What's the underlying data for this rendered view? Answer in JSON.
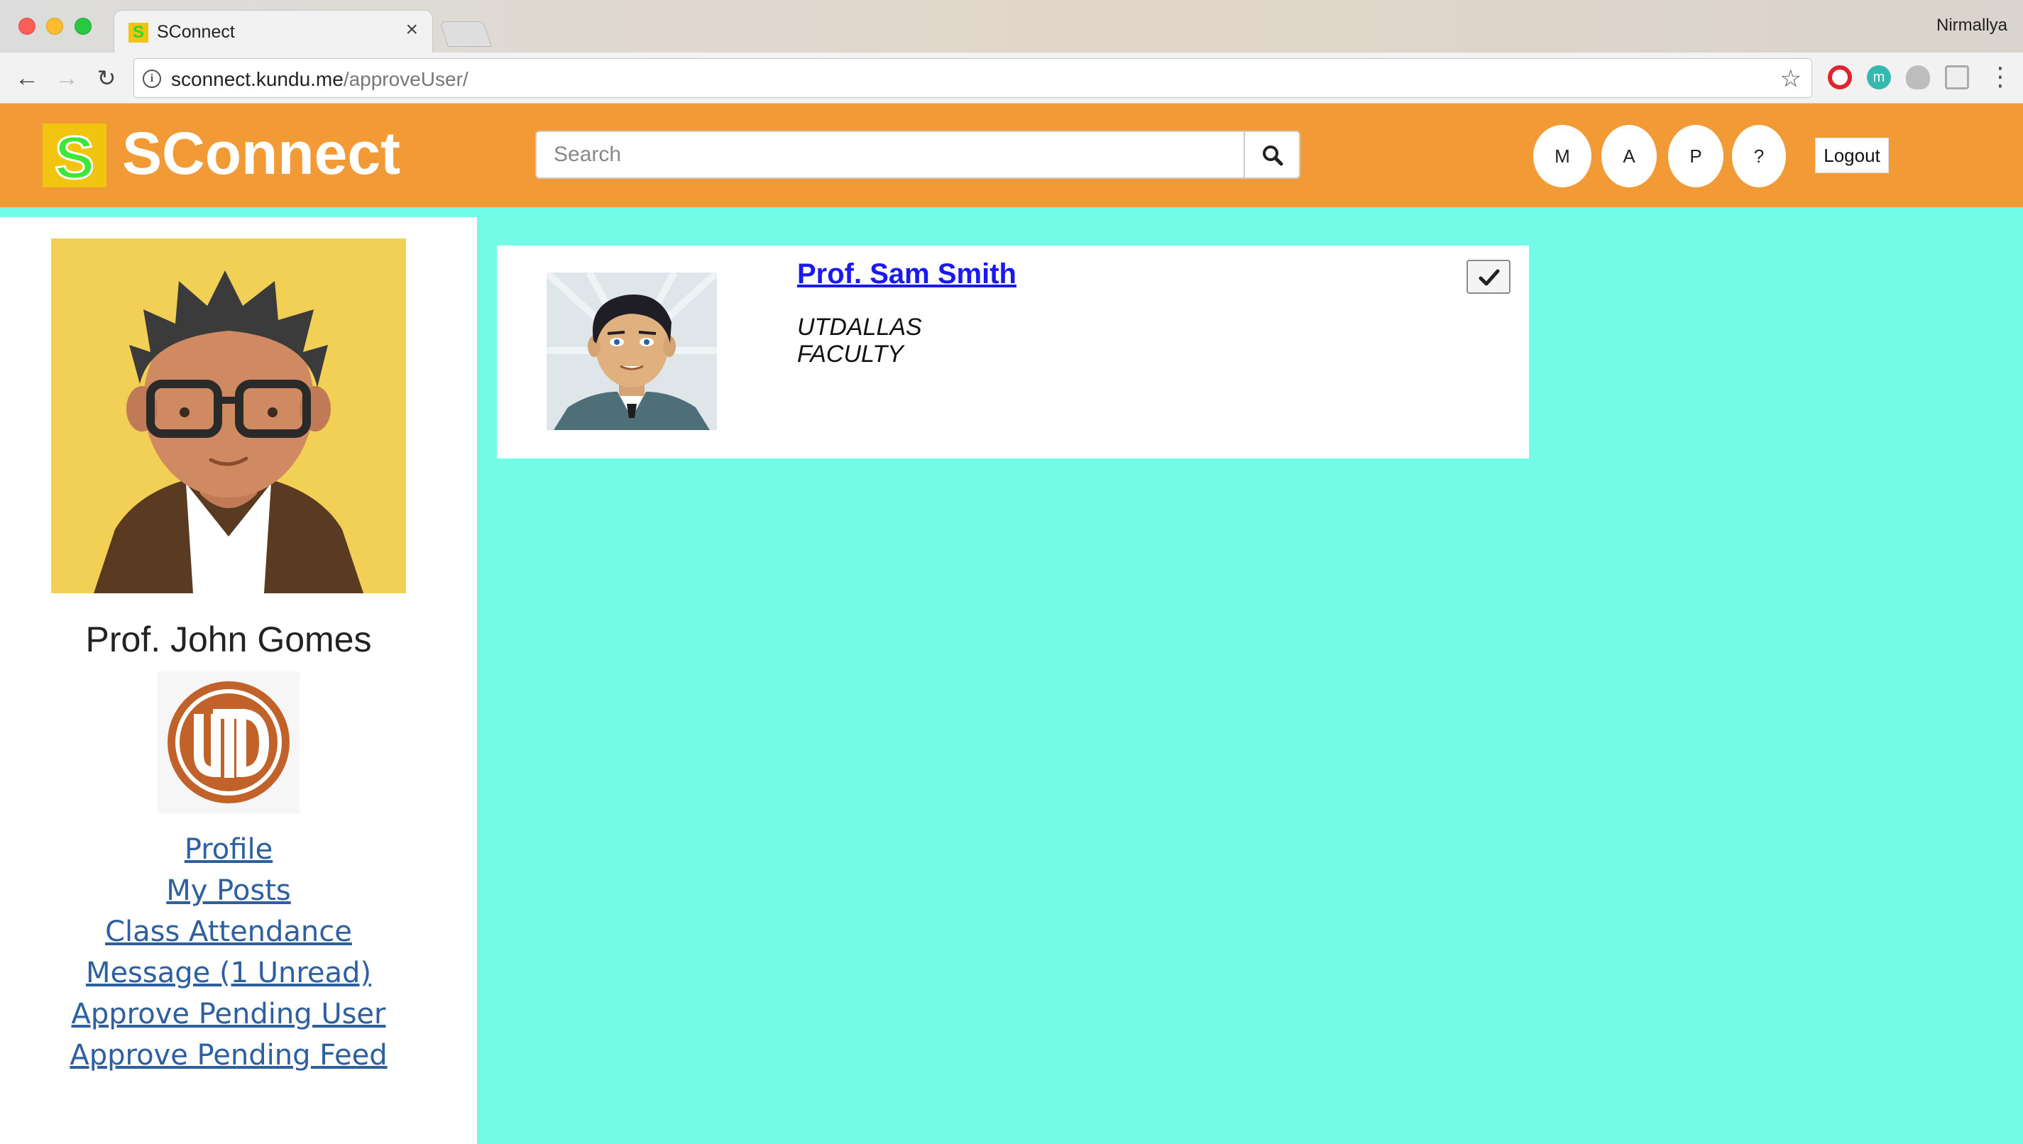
{
  "browser": {
    "tab_title": "SConnect",
    "tab_close": "×",
    "profile_name": "Nirmallya",
    "url_host": "sconnect.kundu.me",
    "url_path": "/approveUser/",
    "ext_m_label": "m"
  },
  "header": {
    "logo_letter": "S",
    "brand": "SConnect",
    "search_placeholder": "Search",
    "buttons": [
      "M",
      "A",
      "P",
      "?"
    ],
    "logout_label": "Logout"
  },
  "sidebar": {
    "user_name": "Prof. John Gomes",
    "nav": [
      {
        "label": "Profile"
      },
      {
        "label": "My Posts"
      },
      {
        "label": "Class Attendance"
      },
      {
        "label": "Message (1 Unread)"
      },
      {
        "label": "Approve Pending User"
      },
      {
        "label": "Approve Pending Feed"
      }
    ]
  },
  "pending_users": [
    {
      "name": "Prof. Sam Smith",
      "organization": "UTDALLAS",
      "role": "FACULTY"
    }
  ],
  "colors": {
    "header_bg": "#f29a36",
    "page_bg": "#72fbe6",
    "link_blue": "#1a1af0",
    "nav_link": "#2e5f9e"
  }
}
